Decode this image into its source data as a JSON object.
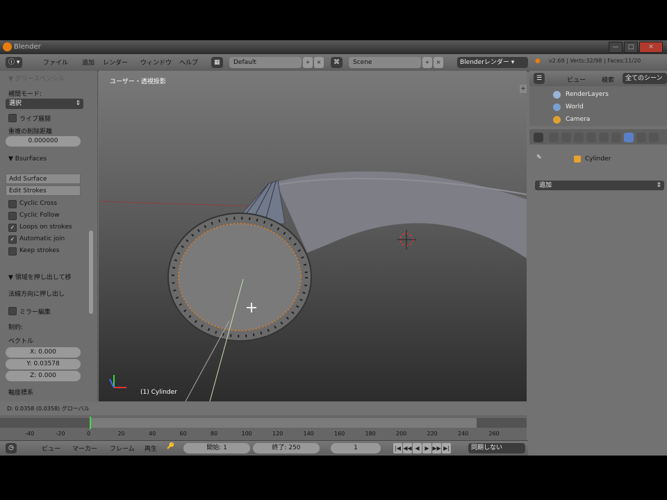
{
  "window": {
    "title": "Blender",
    "min_glyph": "—",
    "max_glyph": "□",
    "close_glyph": "✕"
  },
  "header": {
    "menus": [
      "ファイル",
      "追加",
      "レンダー",
      "ウィンドウ",
      "ヘルプ"
    ],
    "layout_field": "Default",
    "scene_field": "Scene",
    "engine_field": "Blenderレンダー",
    "stats_text": "v2.69 | Verts:32/98 | Faces:11/20",
    "close_glyph": "×",
    "add_glyph": "+",
    "arrow_glyph": "▾"
  },
  "toolshelf": {
    "collapsed_title": "▼ グリースペンシル",
    "section_interp": "補間モード:",
    "interp_value": "選択",
    "live_label": "ライブ展開",
    "overlap_label": "重複の削除距離",
    "overlap_value": "0.000000",
    "bsurfaces_title": "▼ BsurFaces",
    "add_surface": "Add Surface",
    "edit_strokes": "Edit Strokes",
    "check_items": [
      {
        "label": "Cyclic Cross",
        "checked": false
      },
      {
        "label": "Cyclic Follow",
        "checked": false
      },
      {
        "label": "Loops on strokes",
        "checked": true
      },
      {
        "label": "Automatic join",
        "checked": true
      },
      {
        "label": "Keep strokes",
        "checked": false
      }
    ],
    "extrude_title": "▼ 領域を押し出して移",
    "extrude_sub": "法線方向に押し出し",
    "mirror_label": "ミラー編集",
    "constraint_label": "制約:",
    "vector_label": "ベクトル",
    "vector_x": "X: 0.000",
    "vector_y": "Y: 0.03578",
    "vector_z": "Z: 0.000",
    "axis_label": "軸座標系"
  },
  "viewport": {
    "view_label": "ユーザー・透視投影",
    "object_label": "(1) Cylinder",
    "plus": "+"
  },
  "status": {
    "text": "D: 0.0358 (0.0358) グローバル"
  },
  "timeline": {
    "ticks": [
      "-40",
      "-20",
      "0",
      "20",
      "40",
      "60",
      "80",
      "100",
      "120",
      "140",
      "160",
      "180",
      "200",
      "220",
      "240",
      "260"
    ],
    "current_frame": 1,
    "menus": [
      "ビュー",
      "マーカー",
      "フレーム",
      "再生"
    ],
    "start_field": "開始: 1",
    "end_field": "終了: 250",
    "current_field": "1",
    "sync_field": "同期しない",
    "play_glyphs": [
      "|◀",
      "◀◀",
      "◀|",
      "◀",
      "▶",
      "|▶",
      "▶▶",
      "▶|"
    ]
  },
  "outliner": {
    "menus": [
      "ビュー",
      "検索"
    ],
    "filter_field": "全てのシーン",
    "rows": [
      {
        "label": "RenderLayers",
        "color": "#9ab3d8"
      },
      {
        "label": "World",
        "color": "#7aa0d0"
      },
      {
        "label": "Camera",
        "color": "#e0a030"
      }
    ]
  },
  "properties": {
    "context_label": "Cylinder",
    "dropdown_value": "追加",
    "active_tab_color": "#5a7fc7"
  }
}
